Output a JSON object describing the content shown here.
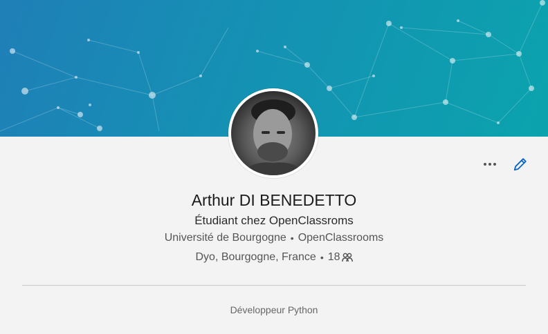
{
  "profile": {
    "name": "Arthur DI BENEDETTO",
    "headline": "Étudiant chez OpenClassroms",
    "school": "Université de Bourgogne",
    "company": "OpenClassrooms",
    "location": "Dyo, Bourgogne, France",
    "connections": "18",
    "bullet": "•"
  },
  "footer": {
    "summary": "Développeur Python"
  },
  "colors": {
    "banner_start": "#1f7fb7",
    "banner_end": "#0ba3ad",
    "edit_icon": "#0a66c2"
  },
  "icons": {
    "more": "more-icon",
    "edit": "pencil-icon",
    "connections": "people-icon"
  }
}
